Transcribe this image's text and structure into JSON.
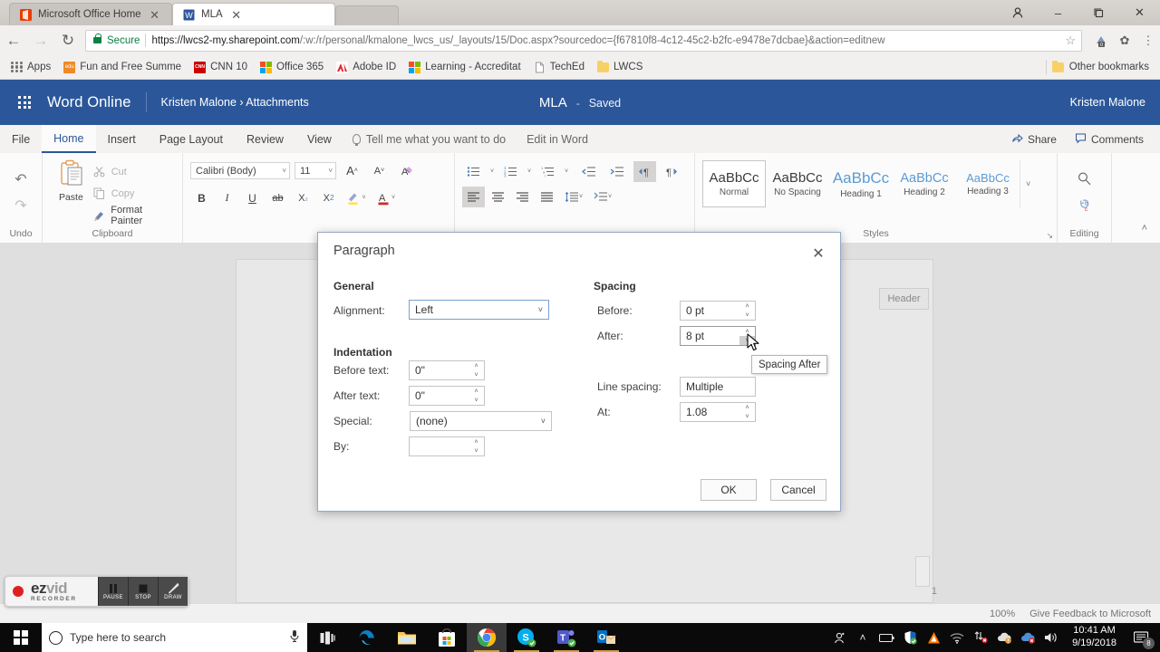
{
  "browser": {
    "tabs": [
      {
        "title": "Microsoft Office Home",
        "icon": "office-icon",
        "active": false
      },
      {
        "title": "MLA",
        "icon": "word-icon",
        "active": true
      }
    ],
    "tab_close_glyph": "✕",
    "nav": {
      "back_glyph": "←",
      "forward_glyph": "→",
      "reload_glyph": "↻"
    },
    "omnibox": {
      "secure_label": "Secure",
      "url_domain": "https://lwcs2-my.sharepoint.com",
      "url_path": "/:w:/r/personal/kmalone_lwcs_us/_layouts/15/Doc.aspx?sourcedoc={f67810f8-4c12-45c2-b2fc-e9478e7dcbae}&action=editnew",
      "star_glyph": "☆"
    },
    "toolbar_icons": [
      {
        "name": "extension-icon",
        "glyph": "◩",
        "badge": "0"
      },
      {
        "name": "puzzle-icon",
        "glyph": "✿"
      },
      {
        "name": "chrome-menu-icon",
        "glyph": "⋮"
      }
    ],
    "window_controls": {
      "profile_glyph": "●",
      "minimize_glyph": "–",
      "maximize_glyph": "❐",
      "close_glyph": "✕"
    },
    "bookmarks": [
      {
        "label": "Apps",
        "icon": "apps-grid-icon"
      },
      {
        "label": "Fun and Free Summe",
        "icon": "edu-icon"
      },
      {
        "label": "CNN 10",
        "icon": "cnn-icon"
      },
      {
        "label": "Office 365",
        "icon": "microsoft-icon"
      },
      {
        "label": "Adobe ID",
        "icon": "adobe-icon"
      },
      {
        "label": "Learning - Accreditat",
        "icon": "microsoft-icon"
      },
      {
        "label": "TechEd",
        "icon": "page-icon"
      },
      {
        "label": "LWCS",
        "icon": "folder-icon"
      }
    ],
    "other_bookmarks": {
      "label": "Other bookmarks",
      "icon": "folder-icon"
    }
  },
  "word": {
    "brand": "Word Online",
    "breadcrumb": "Kristen Malone › Attachments",
    "doc_name": "MLA",
    "doc_dash": "-",
    "save_status": "Saved",
    "user": "Kristen Malone",
    "tabs": [
      {
        "label": "File",
        "active": false
      },
      {
        "label": "Home",
        "active": true
      },
      {
        "label": "Insert",
        "active": false
      },
      {
        "label": "Page Layout",
        "active": false
      },
      {
        "label": "Review",
        "active": false
      },
      {
        "label": "View",
        "active": false
      }
    ],
    "tell_me": "Tell me what you want to do",
    "edit_in_word": "Edit in Word",
    "share": "Share",
    "comments": "Comments",
    "ribbon": {
      "undo_group": {
        "label": "Undo",
        "undo_glyph": "↶",
        "redo_glyph": "↷"
      },
      "clipboard_group": {
        "label": "Clipboard",
        "paste_label": "Paste",
        "cut_label": "Cut",
        "copy_label": "Copy",
        "format_painter_label": "Format Painter"
      },
      "font_group": {
        "font_name": "Calibri (Body)",
        "font_size": "11",
        "grow_glyph": "A",
        "shrink_glyph": "A",
        "clear_format_glyph": "A",
        "bold": "B",
        "italic": "I",
        "underline": "U",
        "strikethrough": "ab",
        "subscript": "X",
        "superscript": "X",
        "highlight_glyph": "✎",
        "fontcolor_glyph": "A"
      },
      "paragraph_group": {
        "bullets_glyph": "☰",
        "numbering_glyph": "☰",
        "multilevel_glyph": "☰",
        "decrease_indent_glyph": "⇤",
        "increase_indent_glyph": "⇥",
        "ltr_glyph": "¶",
        "rtl_glyph": "¶",
        "align_left_glyph": "≡",
        "align_center_glyph": "≡",
        "align_right_glyph": "≡",
        "justify_glyph": "≡",
        "line_spacing_glyph": "↕",
        "paragraph_spacing_glyph": "≡",
        "dialog_launcher_glyph": "↘"
      },
      "styles_group": {
        "label": "Styles",
        "preview_text": "AaBbCc",
        "items": [
          {
            "name": "Normal",
            "selected": true
          },
          {
            "name": "No Spacing",
            "selected": false
          },
          {
            "name": "Heading 1",
            "selected": false
          },
          {
            "name": "Heading 2",
            "selected": false
          },
          {
            "name": "Heading 3",
            "selected": false
          }
        ],
        "more_glyph": "˅",
        "dialog_launcher_glyph": "↘"
      },
      "editing_group": {
        "label": "Editing",
        "find_glyph": "⚲",
        "replace_glyph": "↻",
        "collapse_glyph": "˄"
      }
    }
  },
  "document": {
    "header_placeholder": "Header",
    "page_number": "1"
  },
  "status_bar": {
    "zoom": "100%",
    "feedback": "Give Feedback to Microsoft"
  },
  "dialog": {
    "title": "Paragraph",
    "close_glyph": "✕",
    "sections": {
      "general": "General",
      "indentation": "Indentation",
      "spacing": "Spacing"
    },
    "fields": {
      "alignment": {
        "label": "Alignment:",
        "value": "Left",
        "type": "select"
      },
      "before_text": {
        "label": "Before text:",
        "value": "0\"",
        "type": "spinner"
      },
      "after_text": {
        "label": "After text:",
        "value": "0\"",
        "type": "spinner"
      },
      "special": {
        "label": "Special:",
        "value": "(none)",
        "type": "select"
      },
      "by": {
        "label": "By:",
        "value": "",
        "type": "spinner"
      },
      "spacing_before": {
        "label": "Before:",
        "value": "0 pt",
        "type": "spinner"
      },
      "spacing_after": {
        "label": "After:",
        "value": "8 pt",
        "type": "spinner"
      },
      "line_spacing": {
        "label": "Line spacing:",
        "value": "Multiple",
        "type": "field"
      },
      "at": {
        "label": "At:",
        "value": "1.08",
        "type": "spinner"
      }
    },
    "spinner_up_glyph": "˄",
    "spinner_down_glyph": "˅",
    "select_arrow_glyph": "˅",
    "buttons": {
      "ok": "OK",
      "cancel": "Cancel"
    },
    "tooltip": "Spacing After"
  },
  "recorder": {
    "brand_ez": "ez",
    "brand_vid": "vid",
    "brand_sub": "RECORDER",
    "buttons": [
      {
        "label": "PAUSE",
        "icon": "pause-icon"
      },
      {
        "label": "STOP",
        "icon": "stop-icon"
      },
      {
        "label": "DRAW",
        "icon": "pencil-icon"
      }
    ]
  },
  "taskbar": {
    "search_placeholder": "Type here to search",
    "mic_glyph": "⏺",
    "items": [
      {
        "name": "task-view",
        "glyph": "⌸"
      },
      {
        "name": "edge",
        "glyph": "e"
      },
      {
        "name": "file-explorer",
        "glyph": "▤"
      },
      {
        "name": "microsoft-store",
        "glyph": "▣"
      },
      {
        "name": "google-chrome",
        "glyph": "◉"
      },
      {
        "name": "skype",
        "glyph": "S"
      },
      {
        "name": "microsoft-teams",
        "glyph": "T"
      },
      {
        "name": "outlook",
        "glyph": "O"
      }
    ],
    "tray": [
      {
        "name": "people-icon",
        "glyph": "☺"
      },
      {
        "name": "show-hidden-icons",
        "glyph": "˄"
      },
      {
        "name": "battery-icon",
        "glyph": "▭"
      },
      {
        "name": "windows-defender-icon",
        "glyph": "◆"
      },
      {
        "name": "avast-icon",
        "glyph": "▲"
      },
      {
        "name": "wifi-icon",
        "glyph": "◠"
      },
      {
        "name": "network-icon",
        "glyph": "⇅"
      },
      {
        "name": "onedrive-icon",
        "glyph": "☁"
      },
      {
        "name": "onedrive-business-icon",
        "glyph": "☁"
      },
      {
        "name": "volume-icon",
        "glyph": "🔊"
      }
    ],
    "time": "10:41 AM",
    "date": "9/19/2018",
    "notifications": {
      "glyph": "⌸",
      "count": "8"
    }
  }
}
